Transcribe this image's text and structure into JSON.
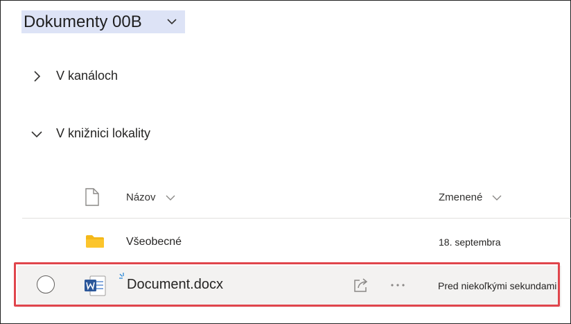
{
  "library": {
    "title": "Dokumenty 00B"
  },
  "sections": {
    "channels_label": "V kanáloch",
    "site_library_label": "V knižnici lokality"
  },
  "columns": {
    "file_type_icon": "document-icon",
    "name_label": "Názov",
    "modified_label": "Zmenené"
  },
  "rows": [
    {
      "icon": "folder-icon",
      "name": "Všeobecné",
      "modified": "18. septembra"
    },
    {
      "icon": "word-file-icon",
      "name": "Document.docx",
      "modified": "Pred niekoľkými sekundami",
      "selected": false,
      "highlighted": true
    }
  ],
  "colors": {
    "title_highlight": "#dde3f6",
    "row_highlight_border": "#e0454c",
    "folder": "#f4b819",
    "word_blue": "#2b579a"
  }
}
